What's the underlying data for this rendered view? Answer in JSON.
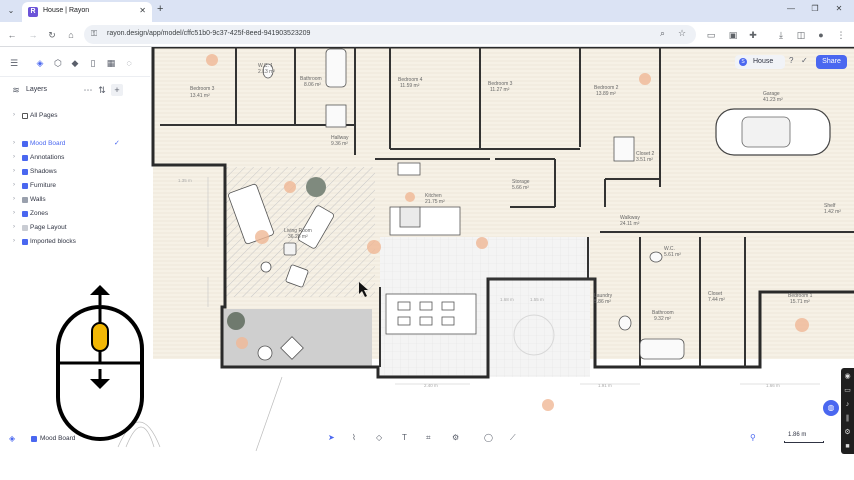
{
  "browser": {
    "tab_title": "House | Rayon",
    "favicon_letter": "R",
    "url": "rayon.design/app/model/cffc51b0-9c37-425f-8eed-941903523209"
  },
  "app": {
    "project_name": "House",
    "share_label": "Share",
    "help_label": "?",
    "layers_title": "Layers",
    "layers": [
      {
        "label": "All Pages",
        "color": "#ffffff",
        "selected": false
      },
      {
        "label": "Mood Board",
        "color": "#4a67f0",
        "selected": true
      },
      {
        "label": "Annotations",
        "color": "#4a67f0",
        "selected": false
      },
      {
        "label": "Shadows",
        "color": "#4a67f0",
        "selected": false
      },
      {
        "label": "Furniture",
        "color": "#4a67f0",
        "selected": false
      },
      {
        "label": "Walls",
        "color": "#9aa0ad",
        "selected": false
      },
      {
        "label": "Zones",
        "color": "#4a67f0",
        "selected": false
      },
      {
        "label": "Page Layout",
        "color": "#c9ccd3",
        "selected": false
      },
      {
        "label": "Imported blocks",
        "color": "#4a67f0",
        "selected": false
      }
    ],
    "active_layer": "Mood Board",
    "scale_label": "1.86 m"
  },
  "plan": {
    "rooms": [
      {
        "name": "Bedroom 3",
        "area": "13.41 m²"
      },
      {
        "name": "W.C. 1",
        "area": "2.13 m²"
      },
      {
        "name": "Bathroom",
        "area": "8.06 m²"
      },
      {
        "name": "Bedroom 4",
        "area": "11.59 m²"
      },
      {
        "name": "Bedroom 3",
        "area": "11.27 m²"
      },
      {
        "name": "Bedroom 2",
        "area": "13.89 m²"
      },
      {
        "name": "Garage",
        "area": "41.23 m²"
      },
      {
        "name": "Hallway",
        "area": "9.36 m²"
      },
      {
        "name": "Kitchen",
        "area": "21.75 m²"
      },
      {
        "name": "Storage",
        "area": "5.66 m²"
      },
      {
        "name": "Living Room",
        "area": "36.28 m²"
      },
      {
        "name": "Walkway",
        "area": "24.11 m²"
      },
      {
        "name": "W.C.",
        "area": "5.61 m²"
      },
      {
        "name": "Laundry",
        "area": "5.86 m²"
      },
      {
        "name": "Closet",
        "area": "7.44 m²"
      },
      {
        "name": "Bathroom",
        "area": "9.32 m²"
      },
      {
        "name": "Bedroom 1",
        "area": "15.71 m²"
      },
      {
        "name": "Shelf",
        "area": "1.42 m²"
      },
      {
        "name": "Closet 2",
        "area": "3.51 m²"
      }
    ],
    "dims": [
      "1.35 m",
      "1.68 m",
      "1.55 m",
      "2.40 m",
      "1.91 m",
      "1.66 m"
    ]
  },
  "icons": {
    "tab_dropdown": "chevron-down-icon",
    "new_tab": "plus-icon"
  }
}
